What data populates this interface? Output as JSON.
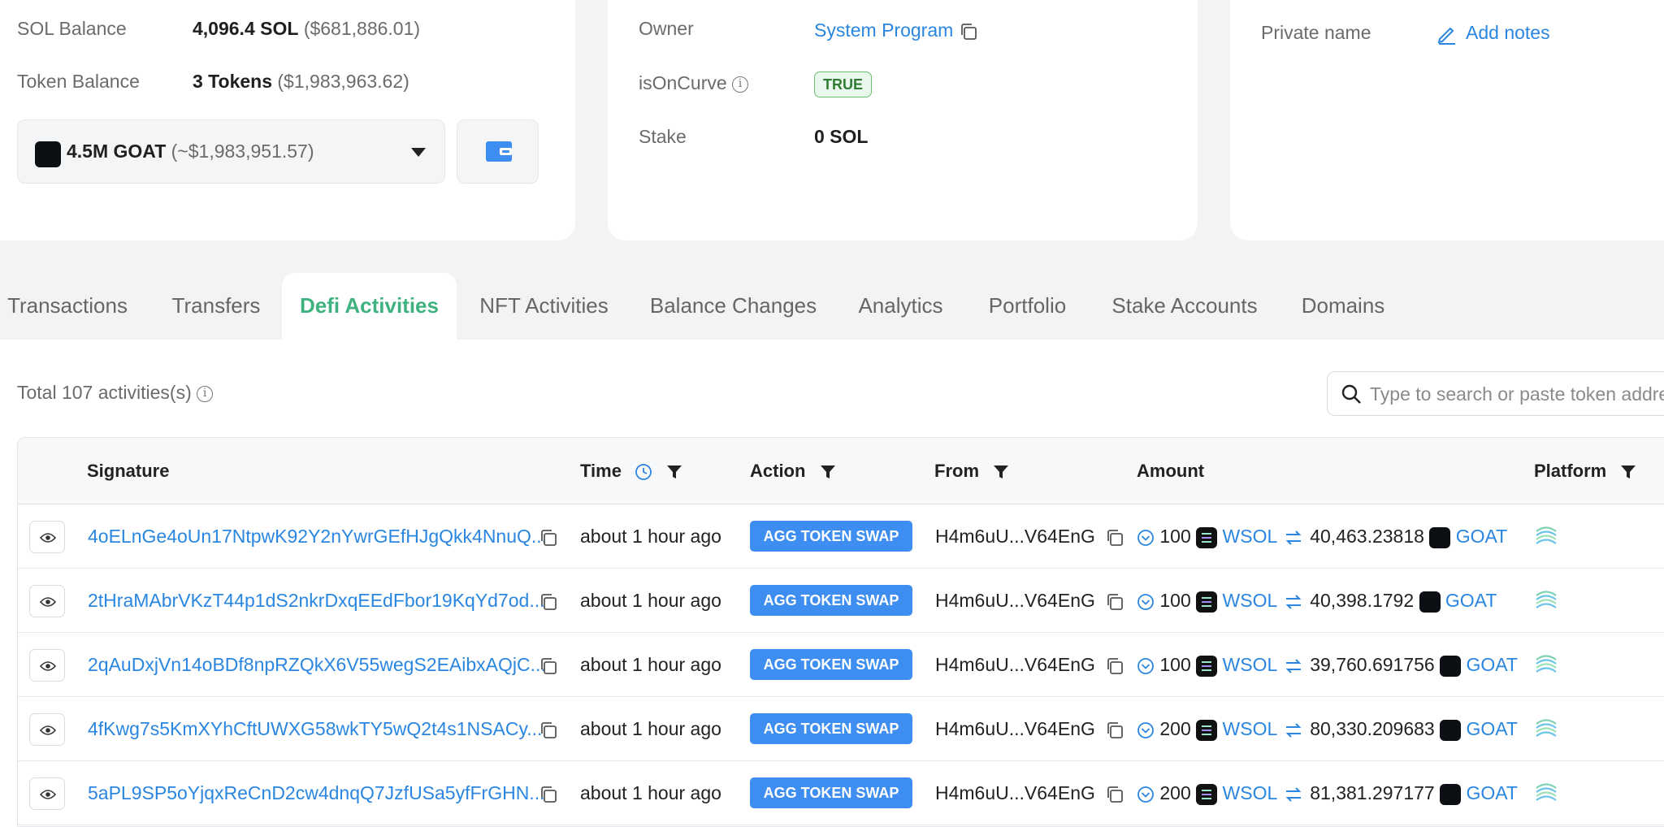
{
  "overview": {
    "sol_balance_label": "SOL Balance",
    "sol_balance_value": "4,096.4 SOL",
    "sol_balance_usd": "($681,886.01)",
    "token_balance_label": "Token Balance",
    "token_balance_value": "3 Tokens",
    "token_balance_usd": "($1,983,963.62)",
    "token_select_amount": "4.5M GOAT",
    "token_select_usd": "(~$1,983,951.57)"
  },
  "more_info": {
    "owner_label": "Owner",
    "owner_value": "System Program",
    "is_on_curve_label": "isOnCurve",
    "is_on_curve_value": "TRUE",
    "stake_label": "Stake",
    "stake_value": "0 SOL"
  },
  "notes": {
    "private_name_label": "Private name",
    "add_notes_label": "Add notes"
  },
  "tabs": [
    {
      "label": "Transactions"
    },
    {
      "label": "Transfers"
    },
    {
      "label": "Defi Activities"
    },
    {
      "label": "NFT Activities"
    },
    {
      "label": "Balance Changes"
    },
    {
      "label": "Analytics"
    },
    {
      "label": "Portfolio"
    },
    {
      "label": "Stake Accounts"
    },
    {
      "label": "Domains"
    }
  ],
  "active_tab": "Defi Activities",
  "activities": {
    "total_text": "Total 107 activities(s)",
    "search_placeholder": "Type to search or paste token address",
    "columns": {
      "signature": "Signature",
      "time": "Time",
      "action": "Action",
      "from": "From",
      "amount": "Amount",
      "platform": "Platform"
    },
    "rows": [
      {
        "signature": "4oELnGe4oUn17NtpwK92Y2nYwrGEfHJgQkk4NnuQ...",
        "time": "about 1 hour ago",
        "action": "AGG TOKEN SWAP",
        "from": "H4m6uU...V64EnG",
        "amount_in": "100",
        "token_in": "WSOL",
        "amount_out": "40,463.23818",
        "token_out": "GOAT"
      },
      {
        "signature": "2tHraMAbrVKzT44p1dS2nkrDxqEEdFbor19KqYd7od...",
        "time": "about 1 hour ago",
        "action": "AGG TOKEN SWAP",
        "from": "H4m6uU...V64EnG",
        "amount_in": "100",
        "token_in": "WSOL",
        "amount_out": "40,398.1792",
        "token_out": "GOAT"
      },
      {
        "signature": "2qAuDxjVn14oBDf8npRZQkX6V55wegS2EAibxAQjC...",
        "time": "about 1 hour ago",
        "action": "AGG TOKEN SWAP",
        "from": "H4m6uU...V64EnG",
        "amount_in": "100",
        "token_in": "WSOL",
        "amount_out": "39,760.691756",
        "token_out": "GOAT"
      },
      {
        "signature": "4fKwg7s5KmXYhCftUWXG58wkTY5wQ2t4s1NSACy...",
        "time": "about 1 hour ago",
        "action": "AGG TOKEN SWAP",
        "from": "H4m6uU...V64EnG",
        "amount_in": "200",
        "token_in": "WSOL",
        "amount_out": "80,330.209683",
        "token_out": "GOAT"
      },
      {
        "signature": "5aPL9SP5oYjqxReCnD2cw4dnqQ7JzfUSa5yfFrGHN...",
        "time": "about 1 hour ago",
        "action": "AGG TOKEN SWAP",
        "from": "H4m6uU...V64EnG",
        "amount_in": "200",
        "token_in": "WSOL",
        "amount_out": "81,381.297177",
        "token_out": "GOAT"
      }
    ]
  },
  "colors": {
    "link": "#2a86e0",
    "active_tab": "#3fb27f",
    "action_badge": "#3d8ef0",
    "true_badge": "#2e7d32"
  }
}
